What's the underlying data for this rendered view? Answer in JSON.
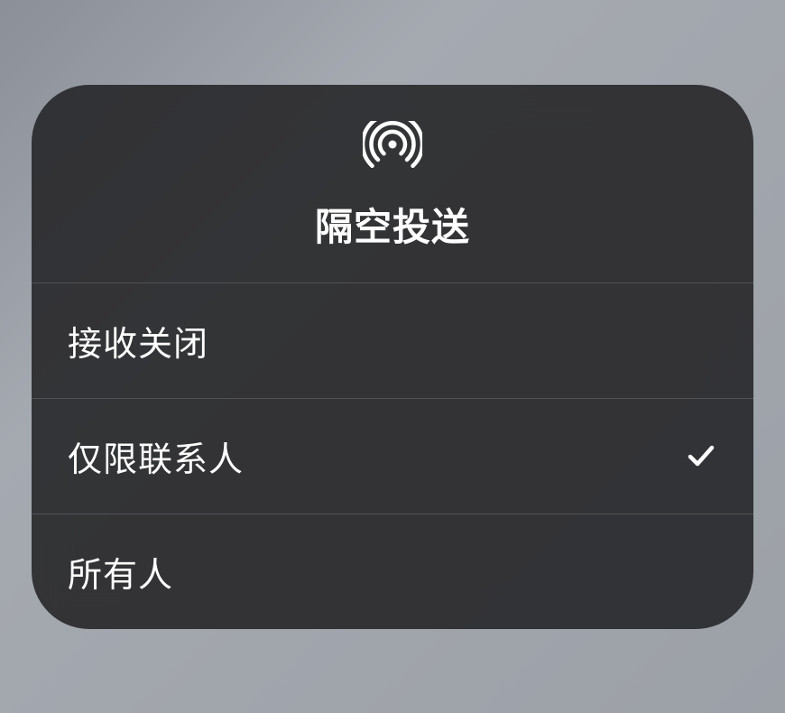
{
  "header": {
    "title": "隔空投送",
    "icon": "airdrop-icon"
  },
  "options": [
    {
      "id": "receiving-off",
      "label": "接收关闭",
      "selected": false
    },
    {
      "id": "contacts-only",
      "label": "仅限联系人",
      "selected": true
    },
    {
      "id": "everyone",
      "label": "所有人",
      "selected": false
    }
  ]
}
